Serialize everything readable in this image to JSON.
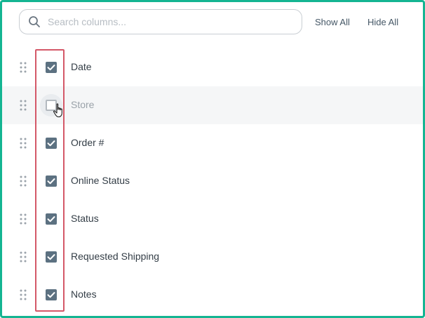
{
  "search": {
    "placeholder": "Search columns...",
    "value": ""
  },
  "actions": {
    "show_all": "Show All",
    "hide_all": "Hide All"
  },
  "columns": [
    {
      "label": "Date",
      "checked": true
    },
    {
      "label": "Store",
      "checked": false
    },
    {
      "label": "Order #",
      "checked": true
    },
    {
      "label": "Online Status",
      "checked": true
    },
    {
      "label": "Status",
      "checked": true
    },
    {
      "label": "Requested Shipping",
      "checked": true
    },
    {
      "label": "Notes",
      "checked": true
    }
  ],
  "colors": {
    "frame_border": "#14b592",
    "checkbox_checked": "#5c7181",
    "highlight_box": "#d45868"
  }
}
